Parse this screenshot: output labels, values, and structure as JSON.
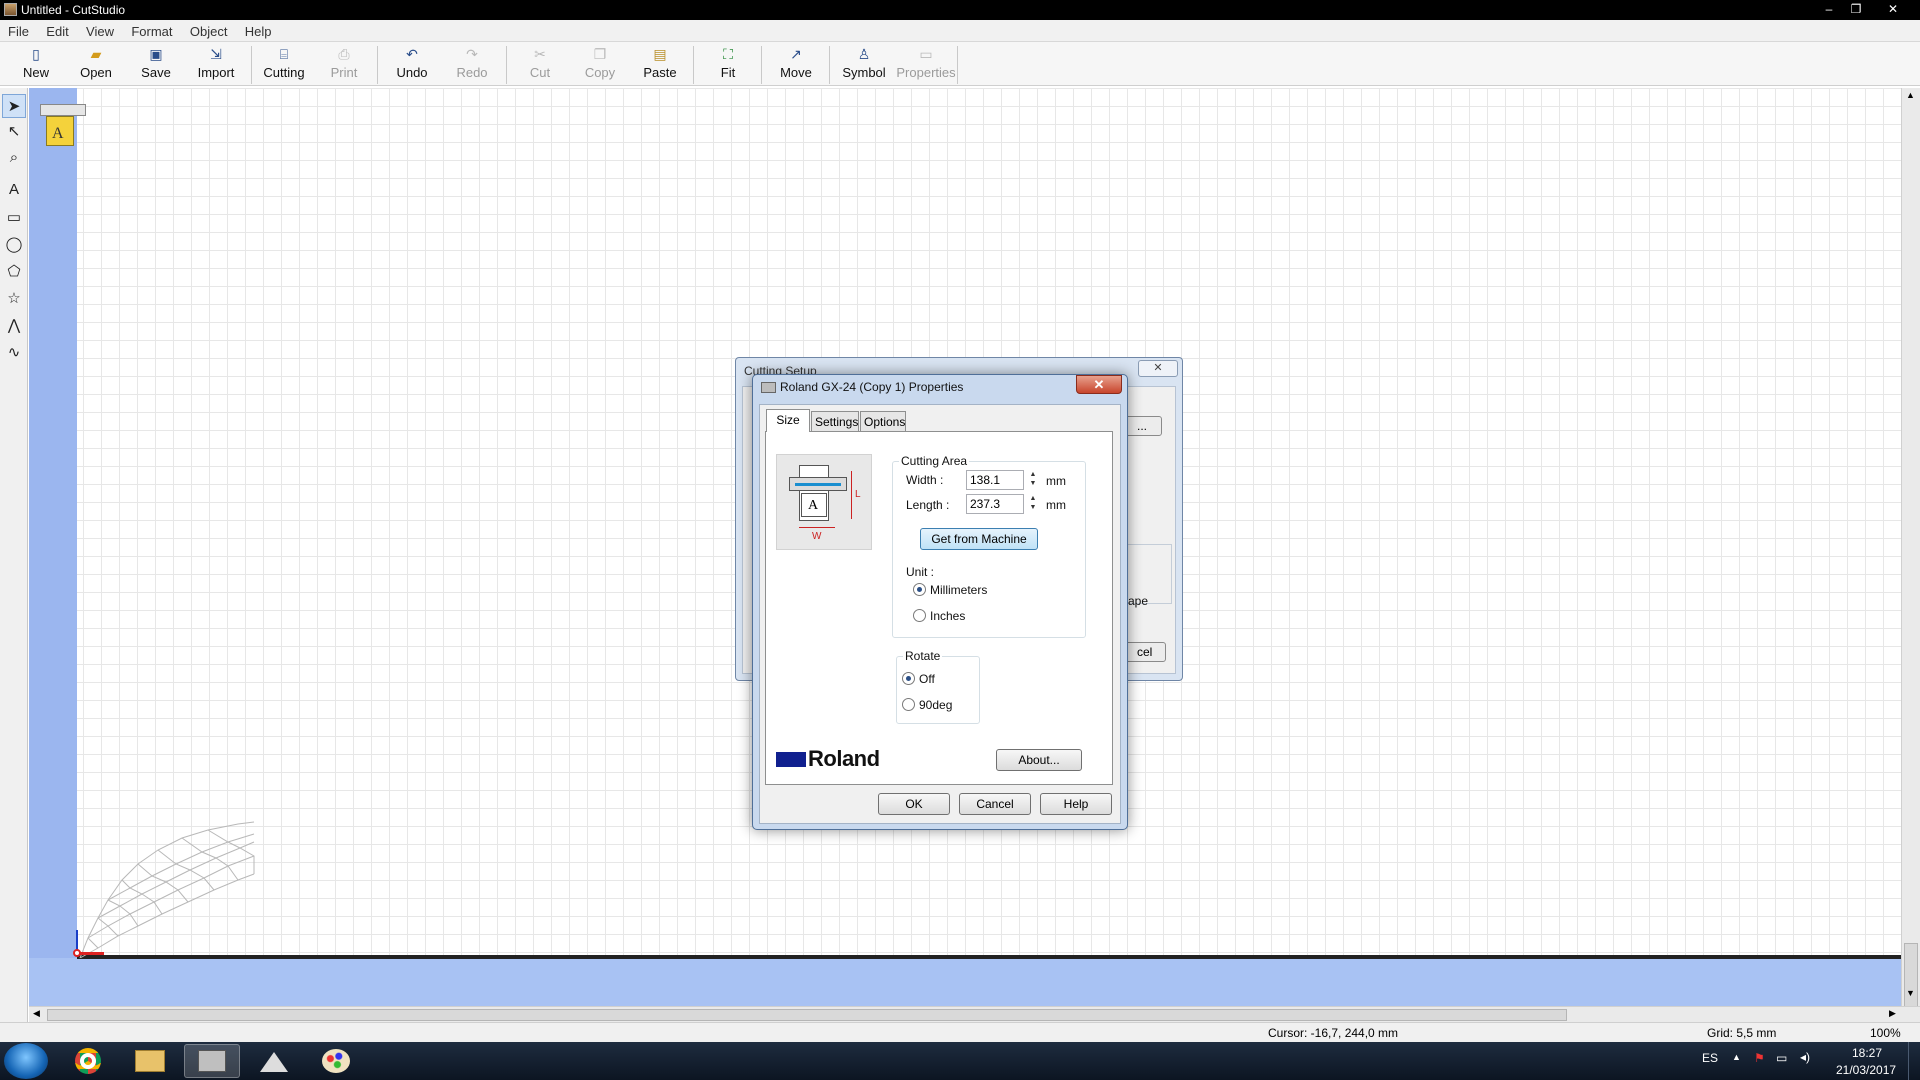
{
  "window": {
    "title": "Untitled - CutStudio",
    "min": "‒",
    "max": "❐",
    "close": "✕"
  },
  "menu": [
    "File",
    "Edit",
    "View",
    "Format",
    "Object",
    "Help"
  ],
  "toolbar": [
    {
      "label": "New",
      "icon": "new-document-icon"
    },
    {
      "label": "Open",
      "icon": "open-folder-icon"
    },
    {
      "label": "Save",
      "icon": "save-disk-icon"
    },
    {
      "label": "Import",
      "icon": "import-icon"
    },
    {
      "label": "Cutting",
      "icon": "cutting-plotter-icon"
    },
    {
      "label": "Print",
      "icon": "print-icon",
      "disabled": true
    },
    {
      "label": "Undo",
      "icon": "undo-icon"
    },
    {
      "label": "Redo",
      "icon": "redo-icon",
      "disabled": true
    },
    {
      "label": "Cut",
      "icon": "scissors-icon",
      "disabled": true
    },
    {
      "label": "Copy",
      "icon": "copy-icon",
      "disabled": true
    },
    {
      "label": "Paste",
      "icon": "paste-icon"
    },
    {
      "label": "Fit",
      "icon": "fit-icon"
    },
    {
      "label": "Move",
      "icon": "move-icon"
    },
    {
      "label": "Symbol",
      "icon": "symbol-icon"
    },
    {
      "label": "Properties",
      "icon": "properties-icon",
      "disabled": true
    }
  ],
  "tools": [
    "select-arrow-icon",
    "edit-points-icon",
    "zoom-icon",
    "text-icon",
    "rectangle-icon",
    "ellipse-icon",
    "polygon-icon",
    "star-icon",
    "polyline-icon",
    "curve-icon"
  ],
  "canvas": {
    "bg_dialog_title": "Cutting Setup",
    "bg_label_ape": "ape",
    "bg_button_cancel": "cel",
    "bg_button_more": "..."
  },
  "dialog": {
    "title": "Roland GX-24 (Copy 1) Properties",
    "tabs": [
      "Size",
      "Settings",
      "Options"
    ],
    "active_tab": "Size",
    "illustration": {
      "l": "L",
      "w": "W",
      "a": "A"
    },
    "cutting_area": {
      "caption": "Cutting Area",
      "width_label": "Width :",
      "width_value": "138.1",
      "width_unit": "mm",
      "length_label": "Length :",
      "length_value": "237.3",
      "length_unit": "mm",
      "get_button": "Get from Machine"
    },
    "unit": {
      "caption": "Unit :",
      "options": [
        "Millimeters",
        "Inches"
      ],
      "selected": "Millimeters"
    },
    "rotate": {
      "caption": "Rotate",
      "options": [
        "Off",
        "90deg"
      ],
      "selected": "Off"
    },
    "brand": "Roland",
    "about_button": "About...",
    "ok_button": "OK",
    "cancel_button": "Cancel",
    "help_button": "Help"
  },
  "status": {
    "cursor": "Cursor: -16,7, 244,0 mm",
    "grid": "Grid: 5,5 mm",
    "zoom": "100%"
  },
  "taskbar": {
    "apps": [
      "chrome-icon",
      "file-explorer-icon",
      "cutstudio-icon",
      "inkscape-icon",
      "paint-icon"
    ],
    "lang": "ES",
    "time": "18:27",
    "date": "21/03/2017"
  }
}
